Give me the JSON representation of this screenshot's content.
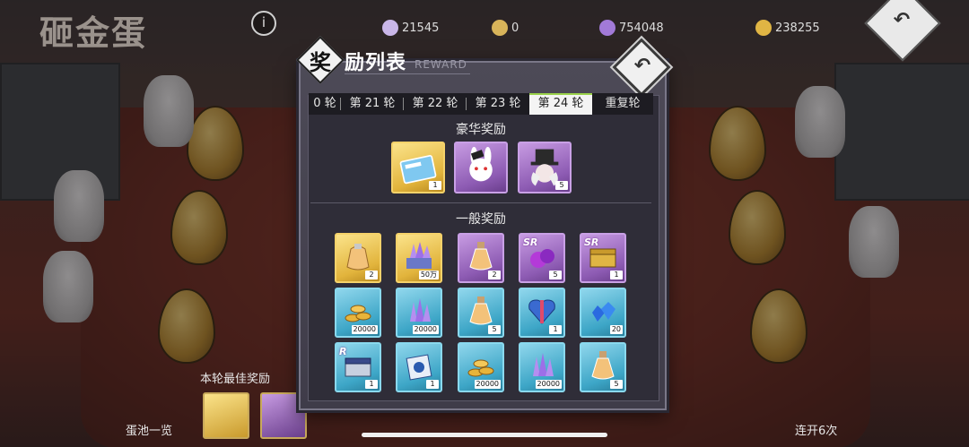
{
  "background": {
    "title": "砸金蛋",
    "resources": [
      {
        "name": "gem-resource",
        "value": "21545",
        "icon": "gem-icon"
      },
      {
        "name": "ticket-resource",
        "value": "0",
        "icon": "ticket-icon"
      },
      {
        "name": "crystal-resource",
        "value": "754048",
        "icon": "crystal-icon"
      },
      {
        "name": "coin-resource",
        "value": "238255",
        "icon": "coin-icon"
      }
    ],
    "best_reward_label": "本轮最佳奖励",
    "egg_pool_label": "蛋池一览",
    "multi_open_label": "连开6次"
  },
  "modal": {
    "title_char": "奖",
    "title_rest": "励列表",
    "subtitle": "REWARD",
    "tabs": [
      "0 轮",
      "第 21 轮",
      "第 22 轮",
      "第 23 轮",
      "第 24 轮",
      "重复轮"
    ],
    "active_tab": "第 24 轮",
    "deluxe_title": "豪华奖励",
    "deluxe_items": [
      {
        "icon": "ticket-card-icon",
        "rarity": "gold",
        "qty": "1"
      },
      {
        "icon": "bunny-character-icon",
        "rarity": "purple",
        "qty": ""
      },
      {
        "icon": "magician-character-icon",
        "rarity": "purple",
        "qty": "5"
      }
    ],
    "normal_title": "一般奖励",
    "normal_items": [
      {
        "icon": "potion-bag-icon",
        "rarity": "gold",
        "qty": "2"
      },
      {
        "icon": "crystal-chest-icon",
        "rarity": "gold",
        "qty": "50万"
      },
      {
        "icon": "potion-flask-icon",
        "rarity": "purple",
        "qty": "2"
      },
      {
        "icon": "sr-material-icon",
        "rarity": "purple",
        "qty": "5",
        "badge": "SR"
      },
      {
        "icon": "sr-chest-icon",
        "rarity": "purple",
        "qty": "1",
        "badge": "SR"
      },
      {
        "icon": "gold-coins-icon",
        "rarity": "blue",
        "qty": "20000"
      },
      {
        "icon": "crystal-shards-icon",
        "rarity": "blue",
        "qty": "20000"
      },
      {
        "icon": "potion-flask-icon",
        "rarity": "blue",
        "qty": "5"
      },
      {
        "icon": "heart-box-icon",
        "rarity": "blue",
        "qty": "1"
      },
      {
        "icon": "blue-gems-icon",
        "rarity": "blue",
        "qty": "20"
      },
      {
        "icon": "r-chest-icon",
        "rarity": "blue",
        "qty": "1",
        "badge": "R"
      },
      {
        "icon": "gift-box-icon",
        "rarity": "blue",
        "qty": "1"
      },
      {
        "icon": "gold-coins-icon",
        "rarity": "blue",
        "qty": "20000"
      },
      {
        "icon": "crystal-shards-icon",
        "rarity": "blue",
        "qty": "20000"
      },
      {
        "icon": "potion-flask-icon",
        "rarity": "blue",
        "qty": "5"
      }
    ]
  },
  "colors": {
    "gold": "#e2b43c",
    "purple": "#8d5bb3",
    "blue": "#3da6c7",
    "active_tab_accent": "#9ad24a"
  }
}
